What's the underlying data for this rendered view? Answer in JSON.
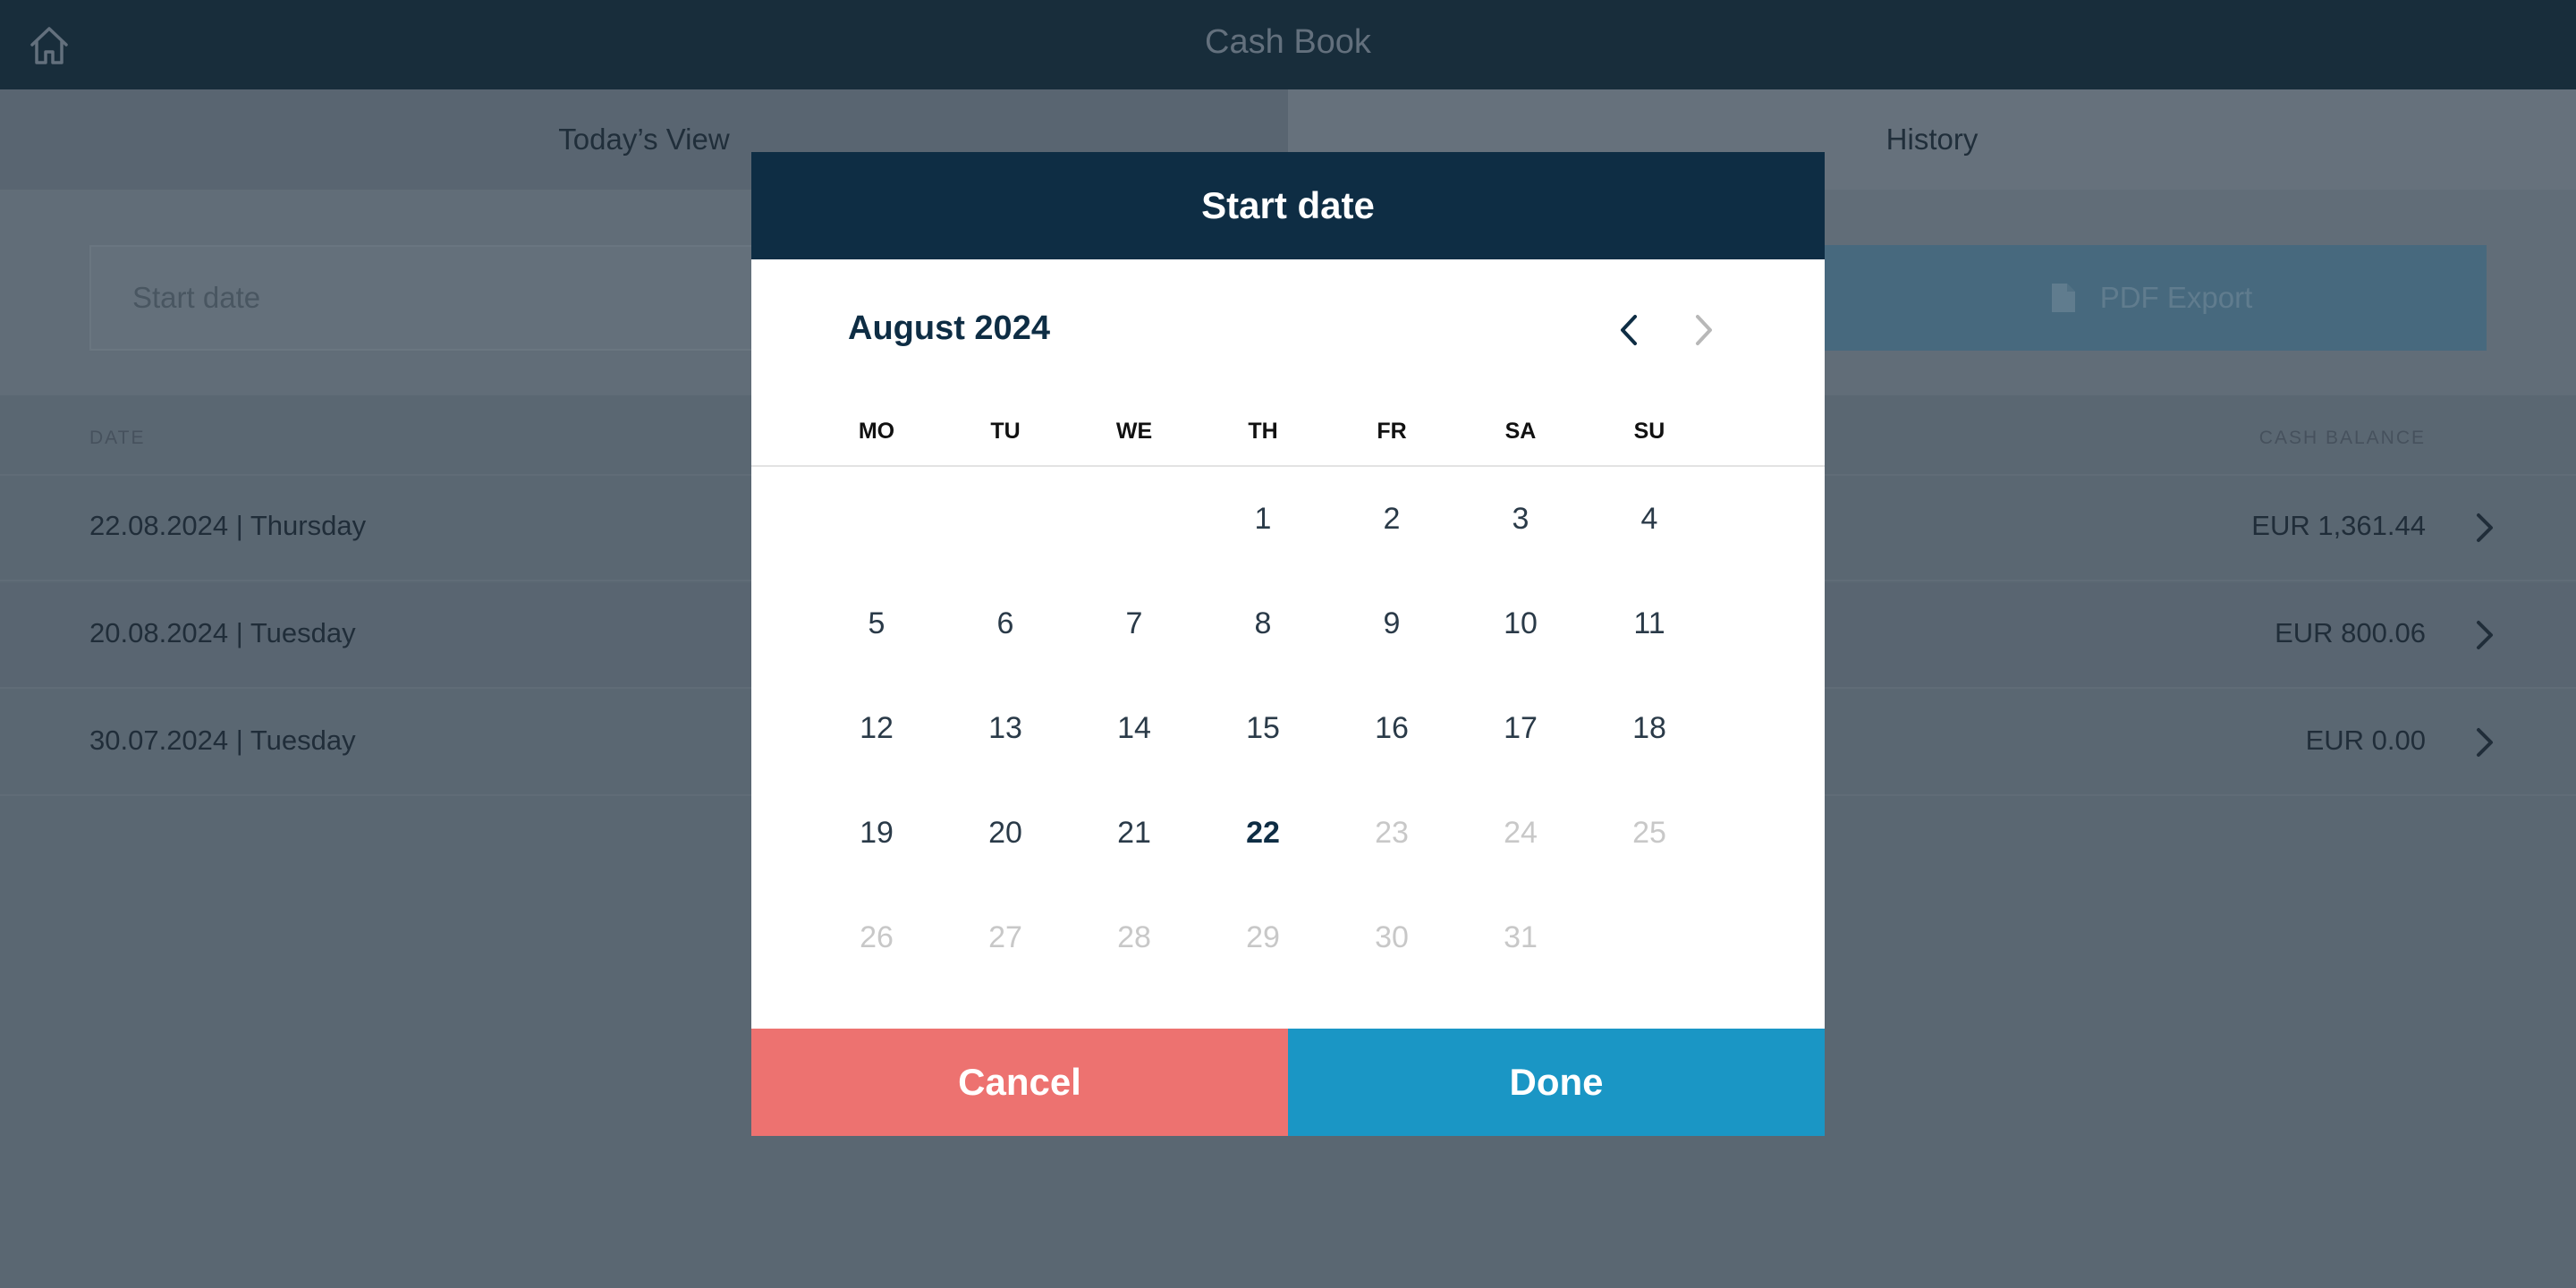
{
  "app": {
    "title": "Cash Book"
  },
  "tabs": [
    {
      "label": "Today’s View"
    },
    {
      "label": "History"
    }
  ],
  "filters": {
    "start_date_placeholder": "Start date",
    "pdf_export_label": "PDF Export"
  },
  "list": {
    "header_date": "DATE",
    "header_balance": "CASH BALANCE",
    "rows": [
      {
        "date": "22.08.2024 | Thursday",
        "balance": "EUR 1,361.44"
      },
      {
        "date": "20.08.2024 | Tuesday",
        "balance": "EUR 800.06"
      },
      {
        "date": "30.07.2024 | Tuesday",
        "balance": "EUR 0.00"
      }
    ]
  },
  "datepicker": {
    "title": "Start date",
    "month_label": "August 2024",
    "weekdays": [
      "MO",
      "TU",
      "WE",
      "TH",
      "FR",
      "SA",
      "SU"
    ],
    "leading_blanks": 3,
    "today": 22,
    "last_enabled_day": 22,
    "days_in_month": 31,
    "cancel_label": "Cancel",
    "done_label": "Done"
  },
  "colors": {
    "header_dark": "#0e2d44",
    "cancel": "#ed7270",
    "done": "#1a96c5",
    "disabled_day": "#c8c8c8"
  },
  "icons": {
    "home": "home-icon",
    "document": "document-icon",
    "chevron_right": "chevron-right-icon",
    "chevron_left": "chevron-left-icon"
  }
}
